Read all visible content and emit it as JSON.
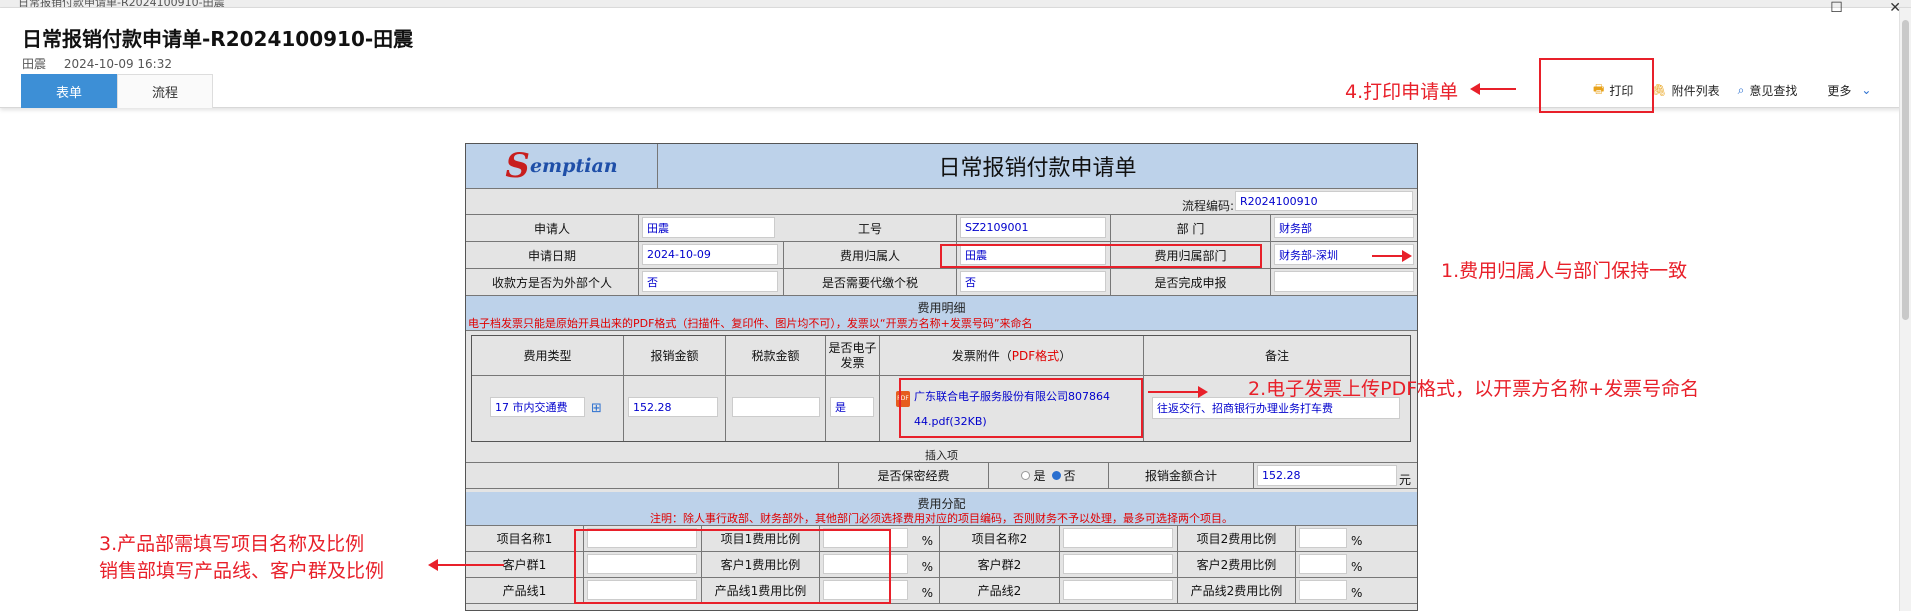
{
  "window": {
    "title": "日常报销付款申请单-R2024100910-田震",
    "min": "—",
    "max": "☐",
    "close": "✕"
  },
  "header": {
    "title": "日常报销付款申请单-R2024100910-田震",
    "user": "田震",
    "datetime": "2024-10-09 16:32",
    "tabs": [
      {
        "label": "表单"
      },
      {
        "label": "流程"
      }
    ],
    "toolbar": {
      "print": "打印",
      "attachments": "附件列表",
      "opinion": "意见查找",
      "more": "更多"
    }
  },
  "form": {
    "logo": {
      "s": "S",
      "text": "emptian"
    },
    "title": "日常报销付款申请单",
    "flow_code_label": "流程编码:",
    "flow_code": "R2024100910",
    "applicant_label": "申请人",
    "applicant": "田震",
    "emp_no_label": "工号",
    "emp_no": "SZ2109001",
    "dept_label": "部 门",
    "dept": "财务部",
    "apply_date_label": "申请日期",
    "apply_date": "2024-10-09",
    "cost_owner_label": "费用归属人",
    "cost_owner": "田震",
    "cost_dept_label": "费用归属部门",
    "cost_dept": "财务部-深圳",
    "external_label": "收款方是否为外部个人",
    "external": "否",
    "withhold_label": "是否需要代缴个税",
    "withhold": "否",
    "declared_label": "是否完成申报",
    "declared": "",
    "detail_band": "费用明细",
    "detail_note": "电子档发票只能是原始开具出来的PDF格式（扫描件、复印件、图片均不可），发票以“开票方名称+发票号码”来命名",
    "detail_headers": {
      "type": "费用类型",
      "amount": "报销金额",
      "tax": "税款金额",
      "einvoice_1": "是否电子",
      "einvoice_2": "发票",
      "attach": "发票附件（",
      "attach_fmt": "PDF格式",
      "attach_end": "）",
      "remark": "备注"
    },
    "detail_row": {
      "type": "17 市内交通费",
      "amount": "152.28",
      "tax": "",
      "einvoice": "是",
      "attach_line1": "广东联合电子服务股份有限公司807864",
      "attach_line2": "44.pdf(32KB)",
      "remark": "往返交行、招商银行办理业务打车费"
    },
    "insert_item": "插入项",
    "confidential_label": "是否保密经费",
    "radio_yes": "是",
    "radio_no": "否",
    "total_label": "报销金额合计",
    "total": "152.28",
    "currency": "元",
    "alloc_band": "费用分配",
    "alloc_note": "注明：除人事行政部、财务部外，其他部门必须选择费用对应的项目编码，否则财务不予以处理，最多可选择两个项目。",
    "alloc": {
      "p1": "项目名称1",
      "p1r": "项目1费用比例",
      "p2": "项目名称2",
      "p2r": "项目2费用比例",
      "c1": "客户群1",
      "c1r": "客户1费用比例",
      "c2": "客户群2",
      "c2r": "客户2费用比例",
      "l1": "产品线1",
      "l1r": "产品线1费用比例",
      "l2": "产品线2",
      "l2r": "产品线2费用比例",
      "pct": "%"
    }
  },
  "annotations": {
    "a1": "1.费用归属人与部门保持一致",
    "a2": "2.电子发票上传PDF格式，以开票方名称+发票号命名",
    "a3_line1": "3.产品部需填写项目名称及比例",
    "a3_line2": "销售部填写产品线、客户群及比例",
    "a4": "4.打印申请单"
  },
  "colors": {
    "annotation": "#e8202a",
    "band": "#bdd2ea",
    "tab_active": "#3d8fd6",
    "value_text": "#0000cc"
  }
}
